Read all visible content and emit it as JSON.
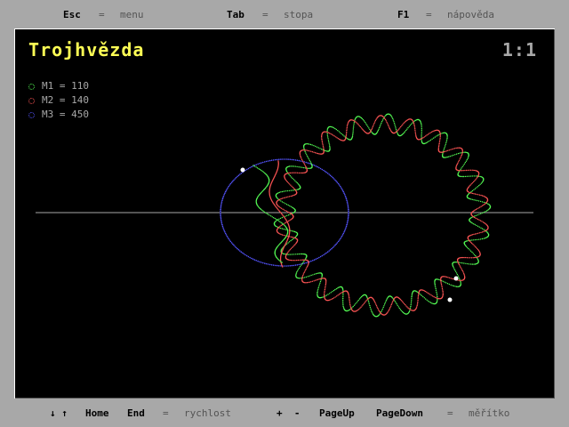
{
  "top": {
    "menu_key": "Esc",
    "menu_desc": "menu",
    "trail_key": "Tab",
    "trail_desc": "stopa",
    "help_key": "F1",
    "help_desc": "nápověda",
    "eq": "="
  },
  "sim": {
    "title": "Trojhvězda",
    "scale": "1:1",
    "masses": [
      {
        "label": "M1 = 110",
        "color": "#55ff55"
      },
      {
        "label": "M2 = 140",
        "color": "#ff5555"
      },
      {
        "label": "M3 = 450",
        "color": "#5555ff"
      }
    ]
  },
  "bottom": {
    "arrows": "↓ ↑",
    "home": "Home",
    "end": "End",
    "speed_desc": "rychlost",
    "plusminus": "+  -",
    "pageup": "PageUp",
    "pagedown": "PageDown",
    "zoom_desc": "měřítko",
    "eq": "="
  },
  "colors": {
    "m1": "#55ff55",
    "m2": "#ff5555",
    "m3": "#5555ff",
    "axis": "#a8a8a8",
    "star": "#ffffff"
  }
}
